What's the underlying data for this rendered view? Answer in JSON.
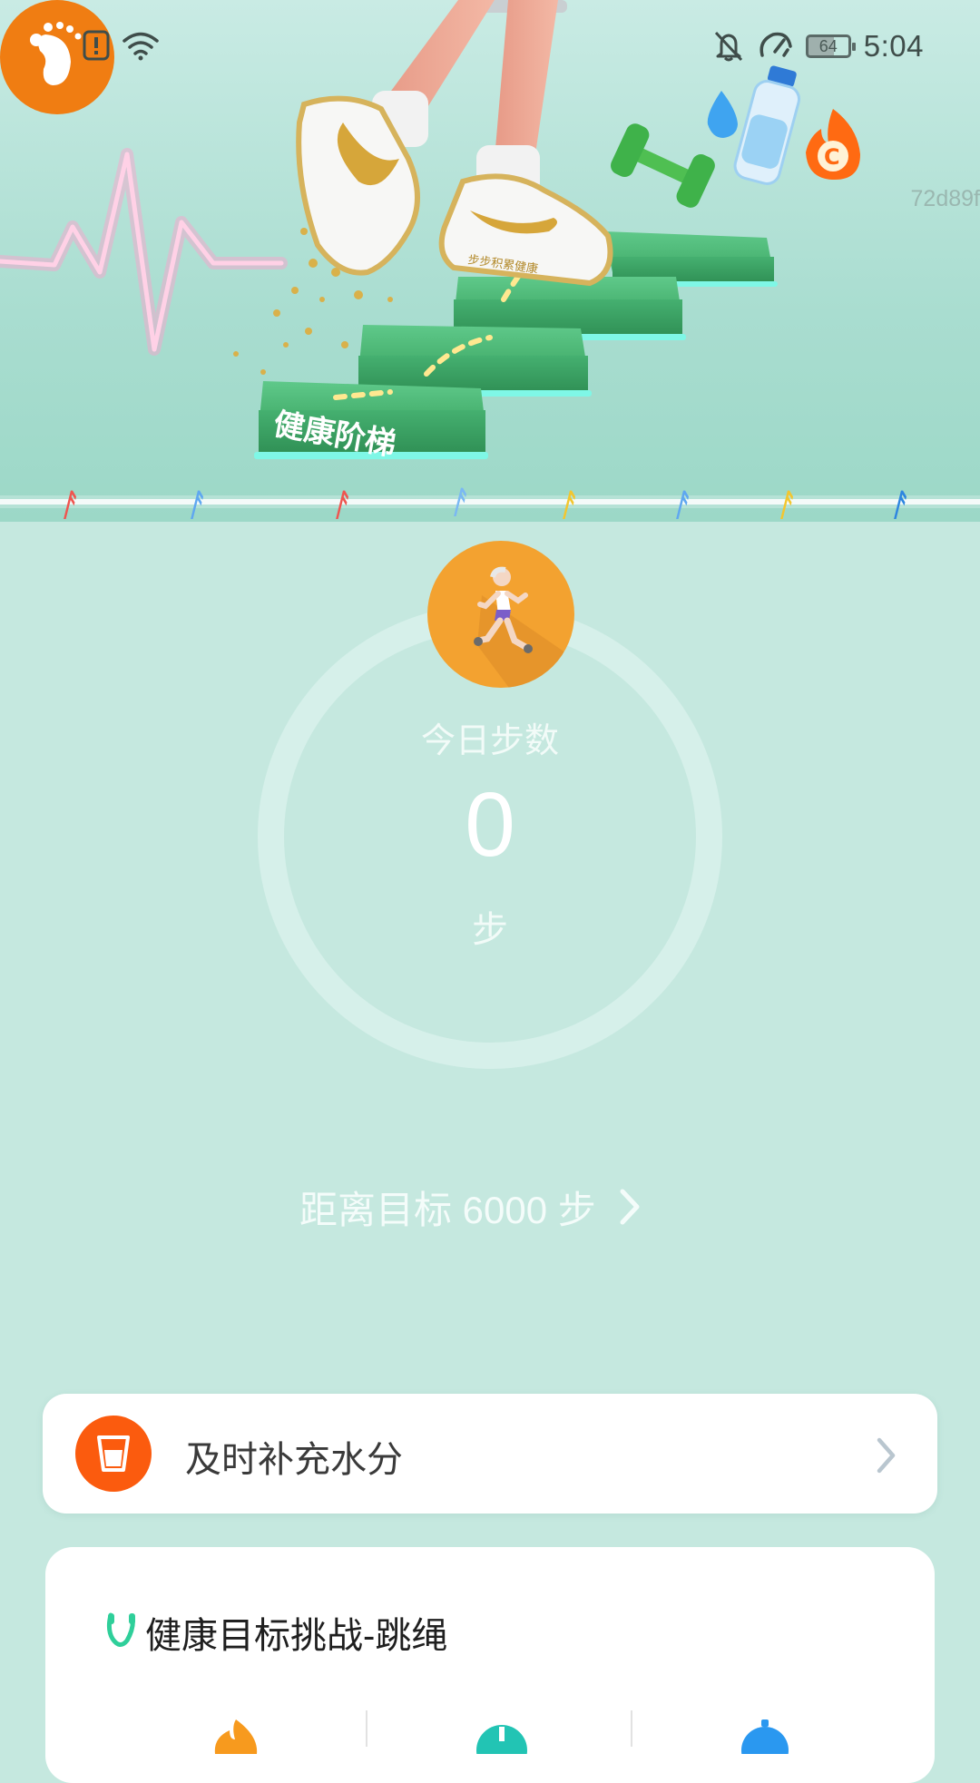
{
  "status_bar": {
    "time": "5:04",
    "battery": "64",
    "icons": [
      "footprint-icon",
      "alert-icon",
      "wifi-icon",
      "bell-off-icon",
      "speed-icon",
      "battery-icon"
    ]
  },
  "banner": {
    "step_text": "健康阶梯",
    "shoe_text": "步步积累健康",
    "code": "72d89f"
  },
  "steps": {
    "label": "今日步数",
    "value": "0",
    "unit": "步"
  },
  "goal": {
    "text": "距离目标 6000 步"
  },
  "water_card": {
    "text": "及时补充水分"
  },
  "challenge_card": {
    "title": "健康目标挑战-跳绳"
  },
  "colors": {
    "background": "#c5e8df",
    "accent_orange": "#f07d12",
    "runner_bg": "#f3a230",
    "water_icon": "#fb5b0e",
    "step_green": "#3aa35d"
  }
}
